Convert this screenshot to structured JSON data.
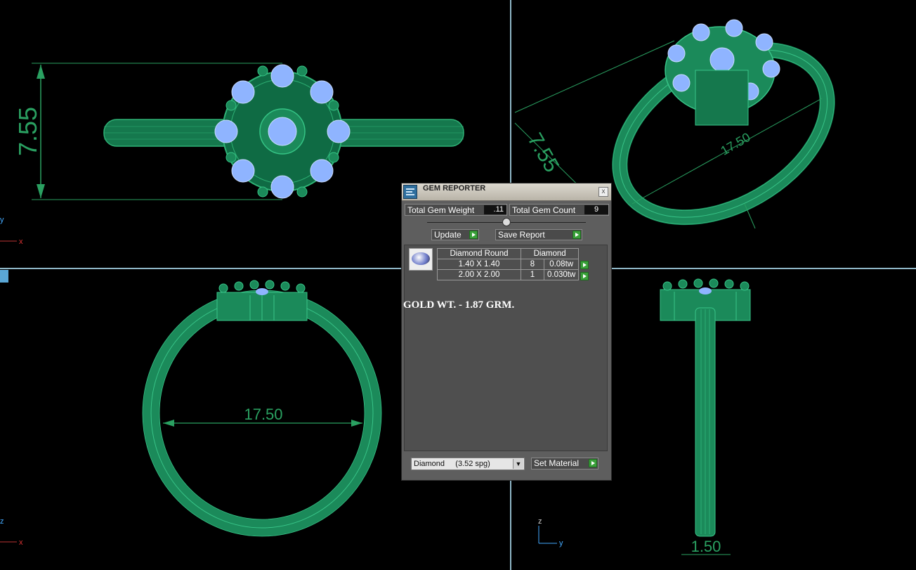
{
  "viewports": {
    "top_view_dimension": "7.55",
    "perspective_height_dimension": "7.55",
    "perspective_length_dimension": "17.50",
    "front_view_diameter": "17.50",
    "side_view_width": "1.50",
    "axis_labels": {
      "top_left_y": "y",
      "top_left_x": "x",
      "bottom_left_z": "z",
      "bottom_left_x": "x",
      "bottom_right_z": "z",
      "bottom_right_y": "y"
    },
    "colors": {
      "metal": "#1b8a5a",
      "gem": "#8fb4ff",
      "dimension": "#2aa061",
      "divider": "#8fb7c7"
    }
  },
  "gem_reporter": {
    "title": "GEM REPORTER",
    "close_glyph": "x",
    "total_gem_weight_label": "Total Gem Weight",
    "total_gem_weight_value": ".11",
    "total_gem_count_label": "Total Gem Count",
    "total_gem_count_value": "9",
    "update_label": "Update",
    "save_report_label": "Save Report",
    "table": {
      "headers": [
        "Diamond Round",
        "Diamond"
      ],
      "rows": [
        {
          "size": "1.40 X 1.40",
          "count": "8",
          "weight": "0.08tw"
        },
        {
          "size": "2.00 X 2.00",
          "count": "1",
          "weight": "0.030tw"
        }
      ]
    },
    "gold_weight_note": "GOLD WT. - 1.87 GRM.",
    "material_select_value": "Diamond     (3.52 spg)",
    "set_material_label": "Set Material"
  }
}
